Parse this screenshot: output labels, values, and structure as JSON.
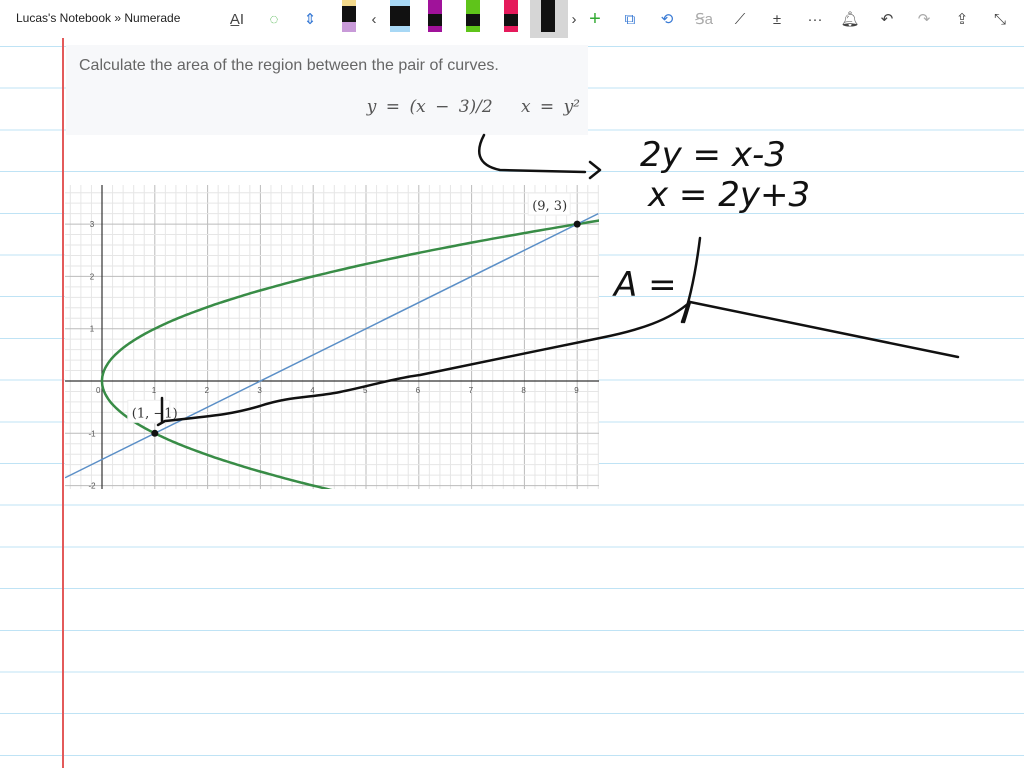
{
  "title": "Lucas's Notebook » Numerade",
  "toolbar": {
    "icons": [
      "text-select-icon",
      "lasso-add-icon",
      "insert-space-icon",
      "highlighter-yellow",
      "pen-blue",
      "pen-purple",
      "pen-green",
      "pen-red",
      "pen-black",
      "add-pen-icon",
      "shapes-icon",
      "ink-to-shape-icon",
      "ink-to-text-icon",
      "ruler-icon",
      "math-icon",
      "more-icon",
      "bell-icon",
      "undo-icon",
      "redo-icon",
      "share-icon",
      "fullscreen-icon"
    ]
  },
  "problem": {
    "text": "Calculate the area of the region between the pair of curves.",
    "eq1": "y = (x − 3)/2",
    "eq2": "x = y²"
  },
  "graph": {
    "x_ticks": [
      "0",
      "1",
      "2",
      "3",
      "4",
      "5",
      "6",
      "7",
      "8",
      "9"
    ],
    "y_ticks": [
      "3",
      "2",
      "1",
      "-1",
      "-2"
    ],
    "point1": "(9, 3)",
    "point2": "(1, −1)",
    "colors": {
      "parabola": "#388c46",
      "line": "#5b8fc7"
    }
  },
  "handwriting": {
    "line1": "2y = x-3",
    "line2": "x = 2y+3",
    "line3": "A ="
  }
}
